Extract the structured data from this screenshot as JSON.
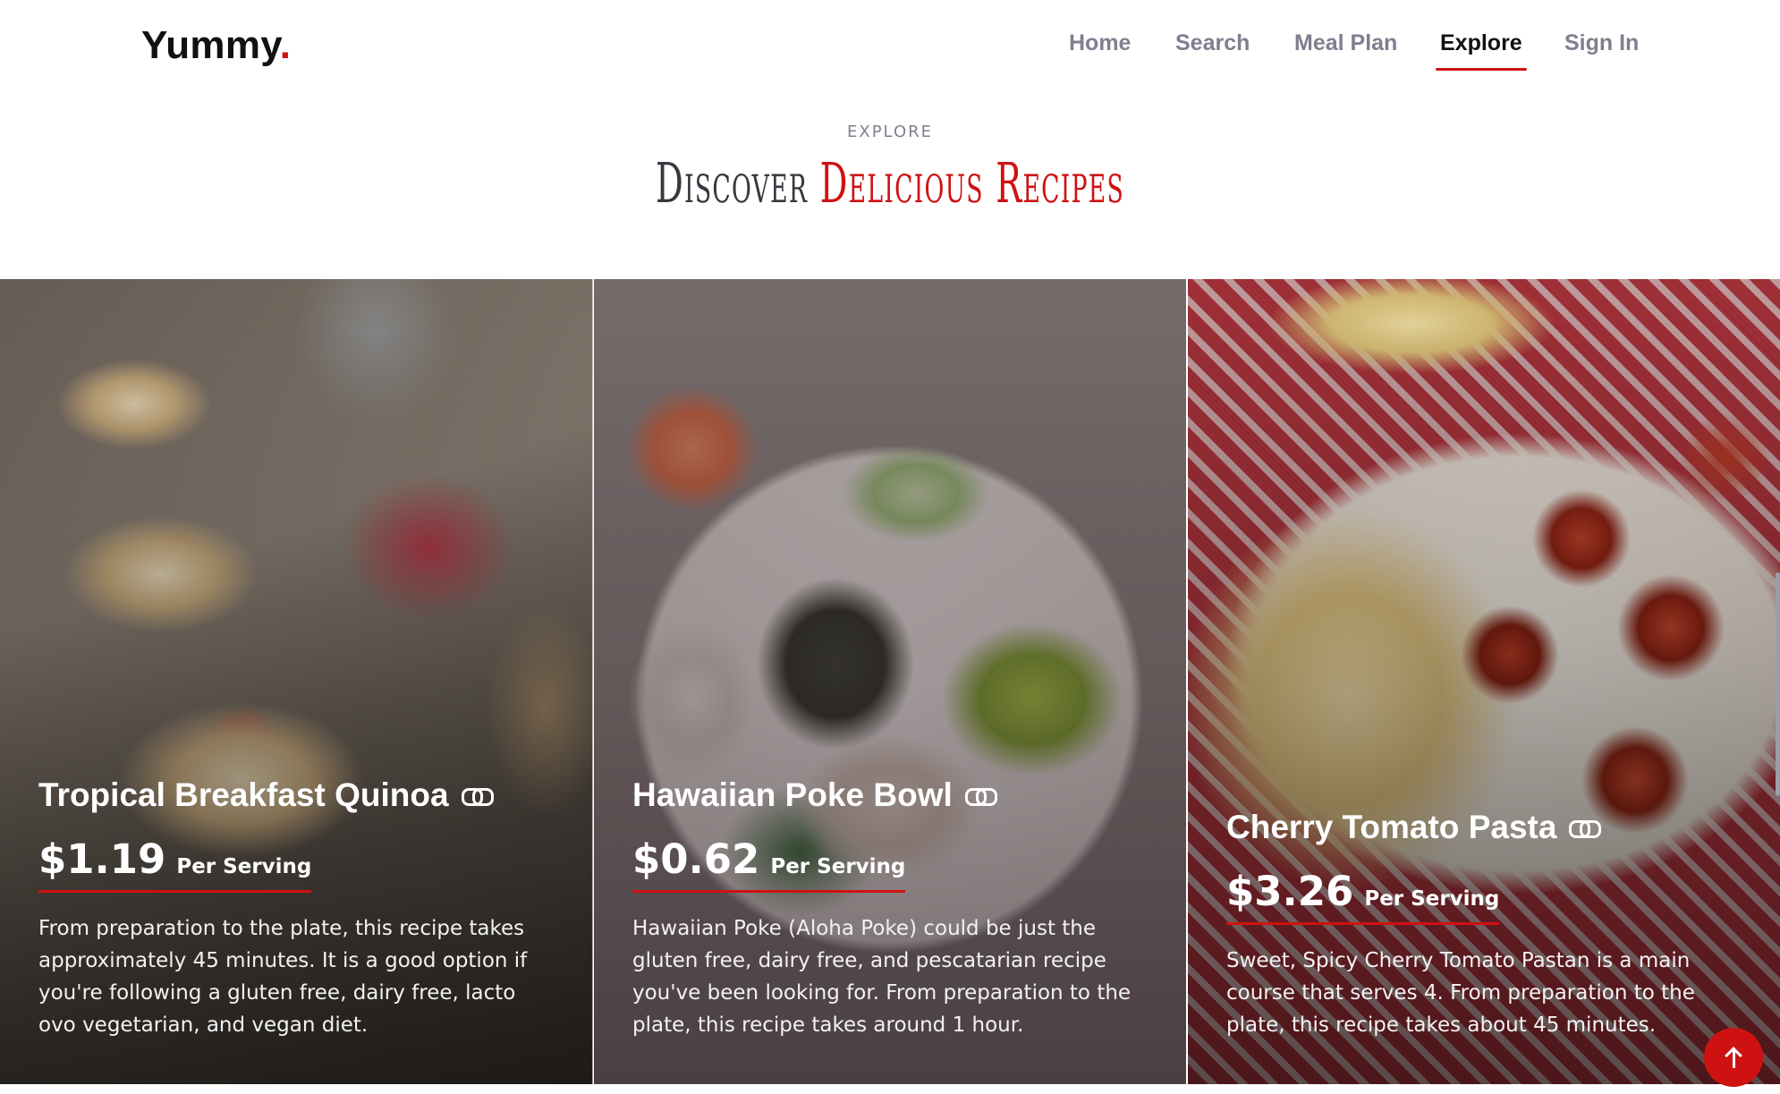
{
  "header": {
    "logo_text": "Yummy",
    "logo_dot": ".",
    "nav": [
      {
        "label": "Home",
        "active": false
      },
      {
        "label": "Search",
        "active": false
      },
      {
        "label": "Meal Plan",
        "active": false
      },
      {
        "label": "Explore",
        "active": true
      },
      {
        "label": "Sign In",
        "active": false
      }
    ]
  },
  "section": {
    "eyebrow": "EXPLORE",
    "title_plain": "Discover",
    "title_accent": "Delicious Recipes"
  },
  "cards": [
    {
      "title": "Tropical Breakfast Quinoa",
      "icon": "link-icon",
      "price": "$1.19",
      "per": "Per Serving",
      "description": "From preparation to the plate, this recipe takes approximately 45 minutes. It is a good option if you're following a gluten free, dairy free, lacto ovo vegetarian, and vegan diet."
    },
    {
      "title": "Hawaiian Poke Bowl",
      "icon": "link-icon",
      "price": "$0.62",
      "per": "Per Serving",
      "description": "Hawaiian Poke (Aloha Poke) could be just the gluten free, dairy free, and pescatarian recipe you've been looking for. From preparation to the plate, this recipe takes around 1 hour."
    },
    {
      "title": "Cherry Tomato Pasta",
      "icon": "link-icon",
      "price": "$3.26",
      "per": "Per Serving",
      "description": "Sweet, Spicy Cherry Tomato Pastan is a main course that serves 4. From preparation to the plate, this recipe takes about 45 minutes."
    }
  ],
  "colors": {
    "accent": "#ce1212",
    "nav_inactive": "#7f7f90",
    "text_dark": "#111111"
  },
  "back_to_top_icon": "arrow-up-icon"
}
